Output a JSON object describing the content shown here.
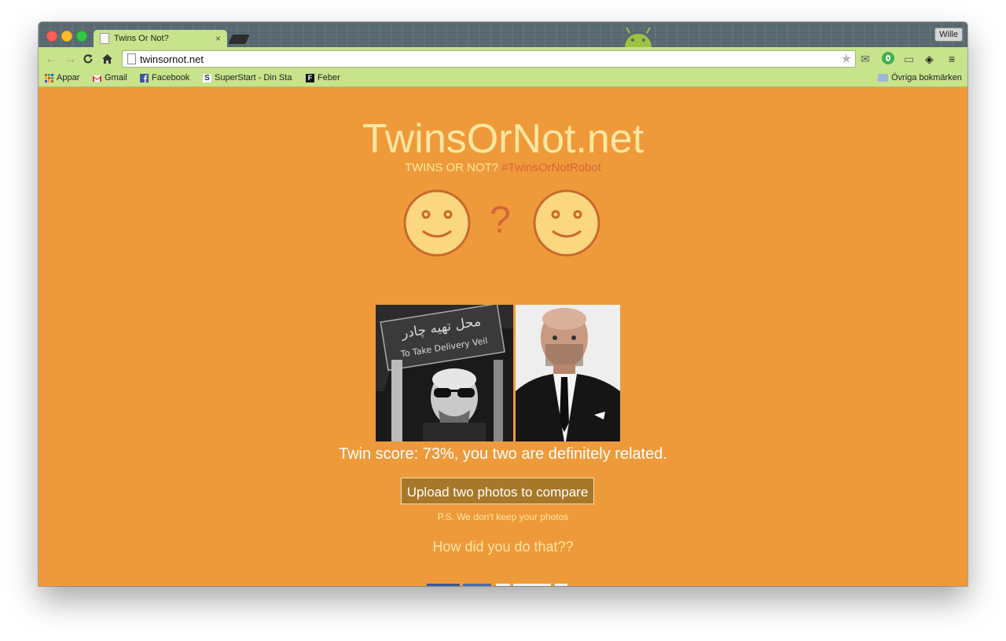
{
  "browser": {
    "tab_title": "Twins Or Not?",
    "tab_close": "×",
    "user_label": "Wille",
    "url": "twinsornot.net",
    "nav": {
      "back": "←",
      "forward": "→",
      "reload": "C",
      "home": "⌂",
      "star": "★"
    },
    "extensions": {
      "mail": "✉",
      "cast": "▭",
      "stack": "◈",
      "menu": "≡"
    },
    "bookmarks": [
      {
        "label": "Appar",
        "icon": "apps-grid-icon"
      },
      {
        "label": "Gmail",
        "icon": "gmail-icon"
      },
      {
        "label": "Facebook",
        "icon": "facebook-icon"
      },
      {
        "label": "SuperStart - Din Sta",
        "icon": "superstart-icon"
      },
      {
        "label": "Feber",
        "icon": "feber-icon"
      }
    ],
    "other_bookmarks": "Övriga bokmärken"
  },
  "page": {
    "title": "TwinsOrNot.net",
    "subtitle_plain": "TWINS OR NOT?",
    "subtitle_hashtag": "#TwinsOrNotRobot",
    "question_mark": "?",
    "photo_left_sign_arabic": "محل تهيه چادر",
    "photo_left_sign_english": "To Take Delivery Veil",
    "score_text": "Twin score: 73%, you two are definitely related.",
    "upload_button": "Upload two photos to compare",
    "ps_note": "P.S. We don't keep your photos",
    "how_link": "How did you do that??"
  },
  "colors": {
    "page_bg": "#ef9a3a",
    "title": "#fde7a2",
    "hashtag": "#d4663a",
    "button_bg": "#a8782a",
    "browser_chrome": "#c7e38b"
  }
}
